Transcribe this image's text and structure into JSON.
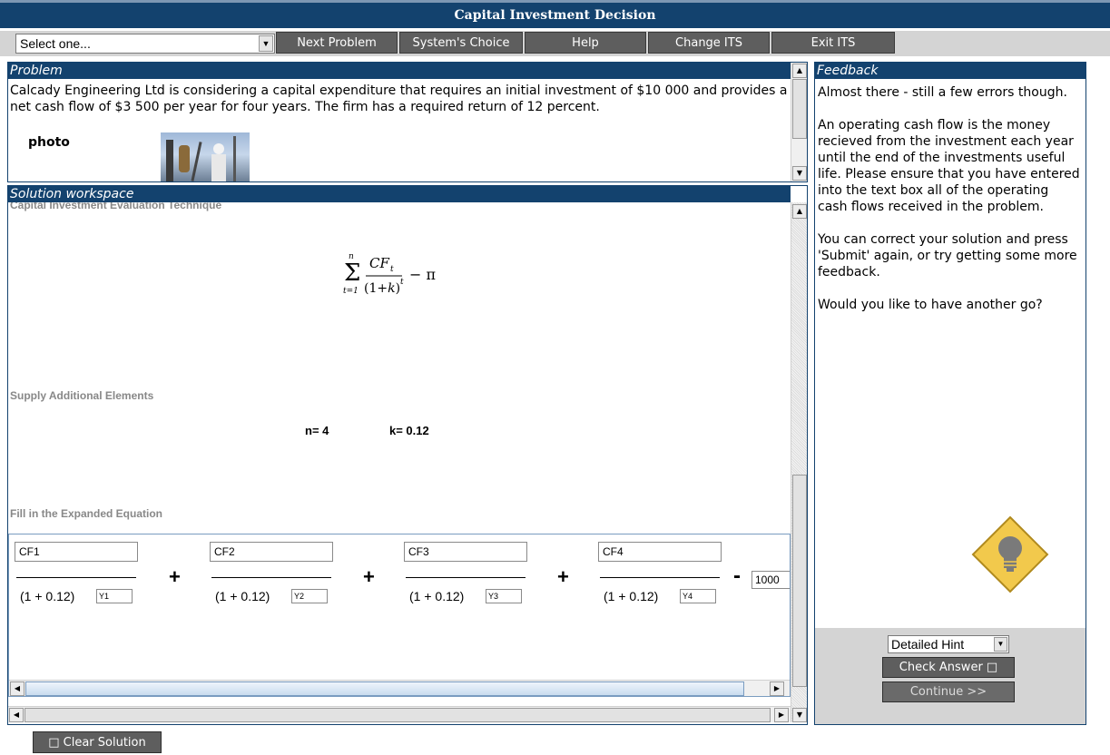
{
  "app": {
    "title": "Capital Investment Decision"
  },
  "toolbar": {
    "select_value": "Select one...",
    "buttons": [
      "Next Problem",
      "System's Choice",
      "Help",
      "Change ITS",
      "Exit ITS"
    ]
  },
  "problem": {
    "header": "Problem",
    "text": "Calcady Engineering Ltd is considering a capital expenditure that requires an initial investment of $10 000 and provides a net cash flow of $3 500 per year for four years. The firm has a required return of 12 percent.",
    "photo_label": "photo"
  },
  "workspace": {
    "header": "Solution workspace",
    "technique_label": "Capital Investment Evaluation Technique",
    "supply_label": "Supply Additional Elements",
    "n_text": "n= 4",
    "k_text": "k= 0.12",
    "fill_label": "Fill in the Expanded Equation",
    "terms": [
      {
        "numerator": "CF1",
        "denominator": "(1 + 0.12)",
        "exponent": "Y1"
      },
      {
        "numerator": "CF2",
        "denominator": "(1 + 0.12)",
        "exponent": "Y2"
      },
      {
        "numerator": "CF3",
        "denominator": "(1 + 0.12)",
        "exponent": "Y3"
      },
      {
        "numerator": "CF4",
        "denominator": "(1 + 0.12)",
        "exponent": "Y4"
      }
    ],
    "operator_plus": "+",
    "operator_minus": "-",
    "investment_value": "1000"
  },
  "feedback": {
    "header": "Feedback",
    "paragraphs": [
      "Almost there - still a few errors though.",
      "An operating cash flow is the money recieved from the investment each year until the end of the investments useful life. Please ensure that you have entered into the text box all of the operating cash flows received in the problem.",
      "You can correct your solution and press 'Submit' again, or try getting some more feedback.",
      "Would you like to have another go?"
    ],
    "hint_select": "Detailed Hint",
    "check_button": "Check Answer □",
    "continue_button": "Continue >>"
  },
  "footer": {
    "clear_button": "□ Clear Solution"
  },
  "colors": {
    "header_bg": "#13426e",
    "button_bg": "#5e5e5e",
    "hint_icon": "#f2c94c"
  }
}
